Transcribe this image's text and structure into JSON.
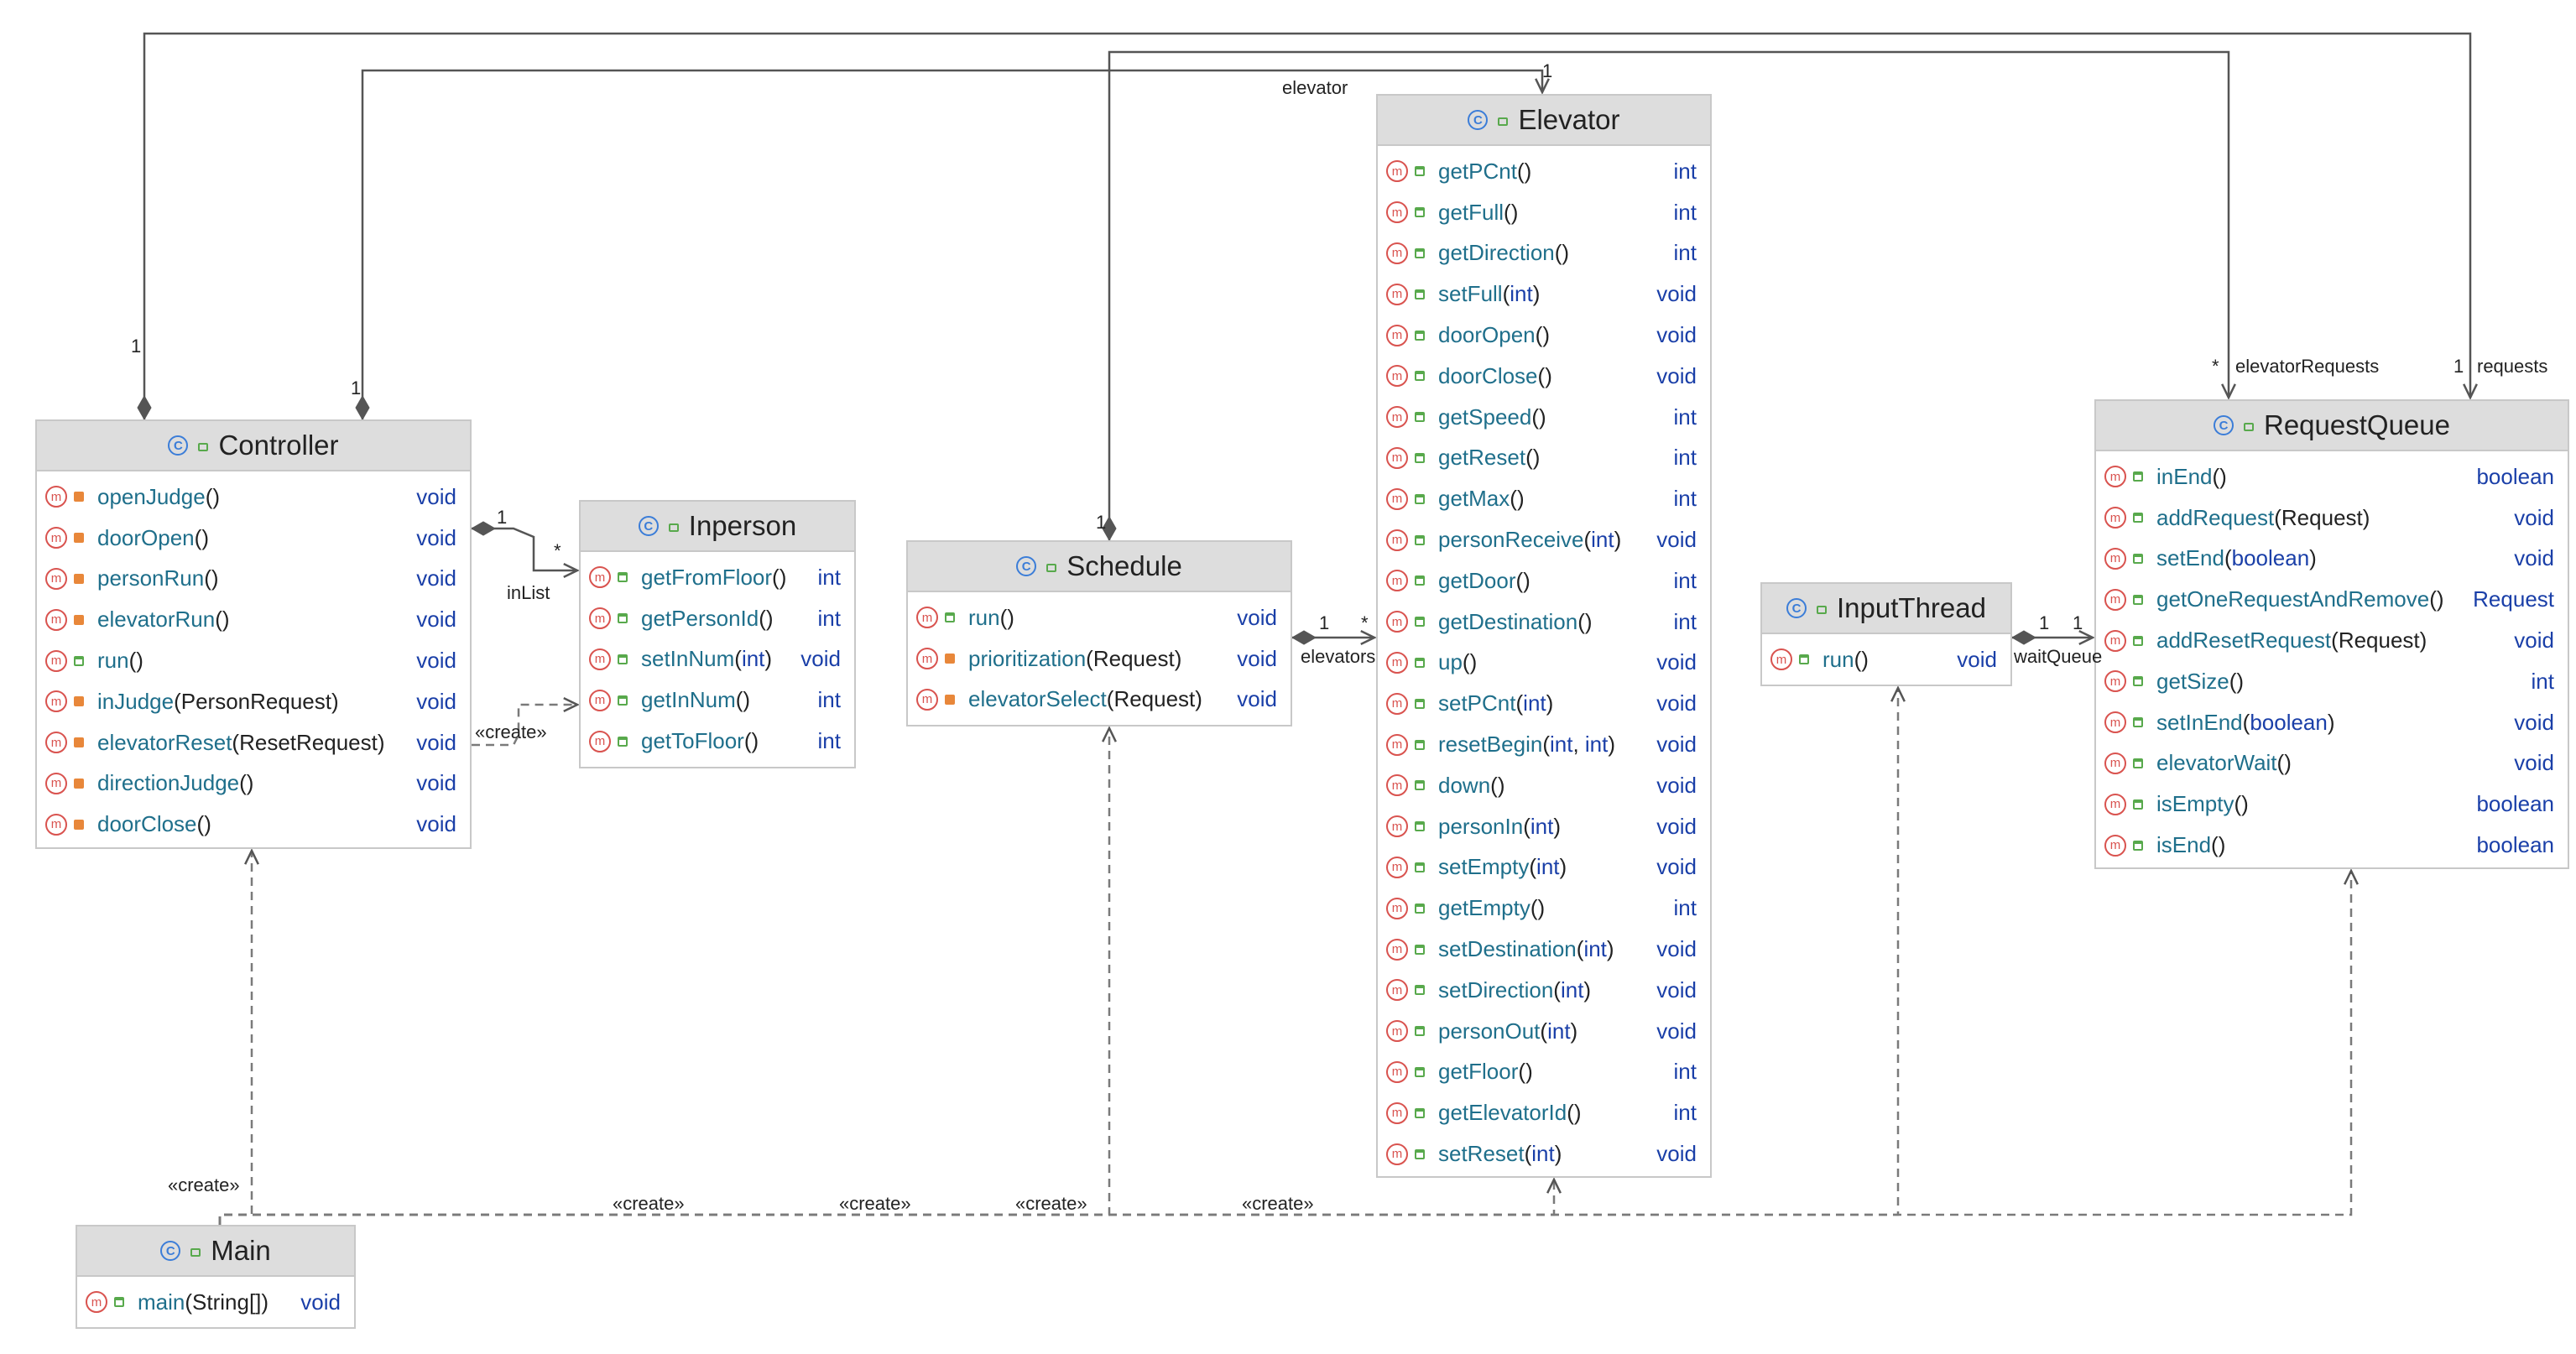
{
  "classes": [
    {
      "id": "controller",
      "name": "Controller",
      "methods": [
        {
          "vis": "private",
          "name": "openJudge",
          "params": [],
          "ret": "void"
        },
        {
          "vis": "private",
          "name": "doorOpen",
          "params": [],
          "ret": "void"
        },
        {
          "vis": "private",
          "name": "personRun",
          "params": [],
          "ret": "void"
        },
        {
          "vis": "private",
          "name": "elevatorRun",
          "params": [],
          "ret": "void"
        },
        {
          "vis": "public",
          "name": "run",
          "params": [],
          "ret": "void"
        },
        {
          "vis": "private",
          "name": "inJudge",
          "params": [
            "PersonRequest"
          ],
          "ret": "void"
        },
        {
          "vis": "private",
          "name": "elevatorReset",
          "params": [
            "ResetRequest"
          ],
          "ret": "void"
        },
        {
          "vis": "private",
          "name": "directionJudge",
          "params": [],
          "ret": "void"
        },
        {
          "vis": "private",
          "name": "doorClose",
          "params": [],
          "ret": "void"
        }
      ]
    },
    {
      "id": "inperson",
      "name": "Inperson",
      "methods": [
        {
          "vis": "public",
          "name": "getFromFloor",
          "params": [],
          "ret": "int"
        },
        {
          "vis": "public",
          "name": "getPersonId",
          "params": [],
          "ret": "int"
        },
        {
          "vis": "public",
          "name": "setInNum",
          "params": [
            "int"
          ],
          "ret": "void"
        },
        {
          "vis": "public",
          "name": "getInNum",
          "params": [],
          "ret": "int"
        },
        {
          "vis": "public",
          "name": "getToFloor",
          "params": [],
          "ret": "int"
        }
      ]
    },
    {
      "id": "schedule",
      "name": "Schedule",
      "methods": [
        {
          "vis": "public",
          "name": "run",
          "params": [],
          "ret": "void"
        },
        {
          "vis": "private",
          "name": "prioritization",
          "params": [
            "Request"
          ],
          "ret": "void"
        },
        {
          "vis": "private",
          "name": "elevatorSelect",
          "params": [
            "Request"
          ],
          "ret": "void"
        }
      ]
    },
    {
      "id": "elevator",
      "name": "Elevator",
      "methods": [
        {
          "vis": "public",
          "name": "getPCnt",
          "params": [],
          "ret": "int"
        },
        {
          "vis": "public",
          "name": "getFull",
          "params": [],
          "ret": "int"
        },
        {
          "vis": "public",
          "name": "getDirection",
          "params": [],
          "ret": "int"
        },
        {
          "vis": "public",
          "name": "setFull",
          "params": [
            "int"
          ],
          "ret": "void"
        },
        {
          "vis": "public",
          "name": "doorOpen",
          "params": [],
          "ret": "void"
        },
        {
          "vis": "public",
          "name": "doorClose",
          "params": [],
          "ret": "void"
        },
        {
          "vis": "public",
          "name": "getSpeed",
          "params": [],
          "ret": "int"
        },
        {
          "vis": "public",
          "name": "getReset",
          "params": [],
          "ret": "int"
        },
        {
          "vis": "public",
          "name": "getMax",
          "params": [],
          "ret": "int"
        },
        {
          "vis": "public",
          "name": "personReceive",
          "params": [
            "int"
          ],
          "ret": "void"
        },
        {
          "vis": "public",
          "name": "getDoor",
          "params": [],
          "ret": "int"
        },
        {
          "vis": "public",
          "name": "getDestination",
          "params": [],
          "ret": "int"
        },
        {
          "vis": "public",
          "name": "up",
          "params": [],
          "ret": "void"
        },
        {
          "vis": "public",
          "name": "setPCnt",
          "params": [
            "int"
          ],
          "ret": "void"
        },
        {
          "vis": "public",
          "name": "resetBegin",
          "params": [
            "int",
            "int"
          ],
          "ret": "void"
        },
        {
          "vis": "public",
          "name": "down",
          "params": [],
          "ret": "void"
        },
        {
          "vis": "public",
          "name": "personIn",
          "params": [
            "int"
          ],
          "ret": "void"
        },
        {
          "vis": "public",
          "name": "setEmpty",
          "params": [
            "int"
          ],
          "ret": "void"
        },
        {
          "vis": "public",
          "name": "getEmpty",
          "params": [],
          "ret": "int"
        },
        {
          "vis": "public",
          "name": "setDestination",
          "params": [
            "int"
          ],
          "ret": "void"
        },
        {
          "vis": "public",
          "name": "setDirection",
          "params": [
            "int"
          ],
          "ret": "void"
        },
        {
          "vis": "public",
          "name": "personOut",
          "params": [
            "int"
          ],
          "ret": "void"
        },
        {
          "vis": "public",
          "name": "getFloor",
          "params": [],
          "ret": "int"
        },
        {
          "vis": "public",
          "name": "getElevatorId",
          "params": [],
          "ret": "int"
        },
        {
          "vis": "public",
          "name": "setReset",
          "params": [
            "int"
          ],
          "ret": "void"
        }
      ]
    },
    {
      "id": "inputthread",
      "name": "InputThread",
      "methods": [
        {
          "vis": "public",
          "name": "run",
          "params": [],
          "ret": "void"
        }
      ]
    },
    {
      "id": "requestqueue",
      "name": "RequestQueue",
      "methods": [
        {
          "vis": "public",
          "name": "inEnd",
          "params": [],
          "ret": "boolean"
        },
        {
          "vis": "public",
          "name": "addRequest",
          "params": [
            "Request"
          ],
          "ret": "void"
        },
        {
          "vis": "public",
          "name": "setEnd",
          "params": [
            "boolean"
          ],
          "ret": "void"
        },
        {
          "vis": "public",
          "name": "getOneRequestAndRemove",
          "params": [],
          "ret": "Request"
        },
        {
          "vis": "public",
          "name": "addResetRequest",
          "params": [
            "Request"
          ],
          "ret": "void"
        },
        {
          "vis": "public",
          "name": "getSize",
          "params": [],
          "ret": "int"
        },
        {
          "vis": "public",
          "name": "setInEnd",
          "params": [
            "boolean"
          ],
          "ret": "void"
        },
        {
          "vis": "public",
          "name": "elevatorWait",
          "params": [],
          "ret": "void"
        },
        {
          "vis": "public",
          "name": "isEmpty",
          "params": [],
          "ret": "boolean"
        },
        {
          "vis": "public",
          "name": "isEnd",
          "params": [],
          "ret": "boolean"
        }
      ]
    },
    {
      "id": "main",
      "name": "Main",
      "methods": [
        {
          "vis": "public",
          "name": "main",
          "params": [
            "String[]"
          ],
          "ret": "void"
        }
      ]
    }
  ],
  "relations": [
    {
      "id": "main-controller-create",
      "type": "dependency",
      "from": "main",
      "to": "controller",
      "label": "«create»"
    },
    {
      "id": "main-schedule-create",
      "type": "dependency",
      "from": "main",
      "to": "schedule",
      "label": "«create»"
    },
    {
      "id": "main-elevator-create",
      "type": "dependency",
      "from": "main",
      "to": "elevator",
      "label": "«create»"
    },
    {
      "id": "main-inputthread-create",
      "type": "dependency",
      "from": "main",
      "to": "inputthread",
      "label": "«create»"
    },
    {
      "id": "main-requestqueue-create",
      "type": "dependency",
      "from": "main",
      "to": "requestqueue",
      "label": "«create»"
    },
    {
      "id": "controller-inperson-create",
      "type": "dependency",
      "from": "controller",
      "to": "inperson",
      "label": "«create»"
    },
    {
      "id": "controller-inperson-inlist",
      "type": "composition",
      "from": "controller",
      "to": "inperson",
      "role": "inList",
      "src_mult": "1",
      "dst_mult": "*"
    },
    {
      "id": "controller-elevator",
      "type": "composition",
      "from": "controller",
      "to": "elevator",
      "role": "elevator",
      "src_mult": "1",
      "dst_mult": "1"
    },
    {
      "id": "controller-requestqueue",
      "type": "composition",
      "from": "controller",
      "to": "requestqueue",
      "role": "requests",
      "src_mult": "1",
      "dst_mult": "1"
    },
    {
      "id": "schedule-requestqueue",
      "type": "composition",
      "from": "schedule",
      "to": "requestqueue",
      "role": "elevatorRequests",
      "src_mult": "1",
      "dst_mult": "*"
    },
    {
      "id": "schedule-elevator",
      "type": "composition",
      "from": "schedule",
      "to": "elevator",
      "role": "elevators",
      "src_mult": "1",
      "dst_mult": "*"
    },
    {
      "id": "inputthread-requestqueue",
      "type": "composition",
      "from": "inputthread",
      "to": "requestqueue",
      "role": "waitQueue",
      "src_mult": "1",
      "dst_mult": "1"
    }
  ]
}
